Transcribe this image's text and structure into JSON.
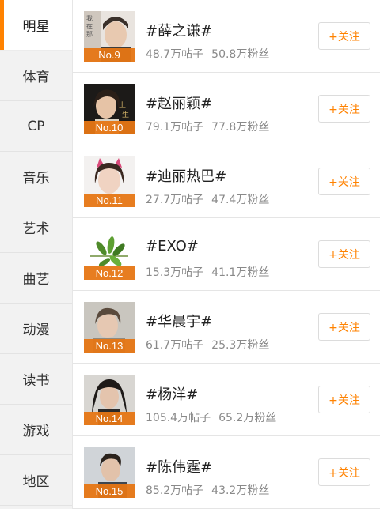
{
  "sidebar": {
    "items": [
      {
        "label": "明星",
        "active": true
      },
      {
        "label": "体育"
      },
      {
        "label": "CP"
      },
      {
        "label": "音乐"
      },
      {
        "label": "艺术"
      },
      {
        "label": "曲艺"
      },
      {
        "label": "动漫"
      },
      {
        "label": "读书"
      },
      {
        "label": "游戏"
      },
      {
        "label": "地区"
      }
    ]
  },
  "list": [
    {
      "rank": "No.9",
      "topic": "#薛之谦#",
      "posts": "48.7万帖子",
      "fans": "50.8万粉丝",
      "follow": "+关注"
    },
    {
      "rank": "No.10",
      "topic": "#赵丽颖#",
      "posts": "79.1万帖子",
      "fans": "77.8万粉丝",
      "follow": "+关注"
    },
    {
      "rank": "No.11",
      "topic": "#迪丽热巴#",
      "posts": "27.7万帖子",
      "fans": "47.4万粉丝",
      "follow": "+关注"
    },
    {
      "rank": "No.12",
      "topic": "#EXO#",
      "posts": "15.3万帖子",
      "fans": "41.1万粉丝",
      "follow": "+关注"
    },
    {
      "rank": "No.13",
      "topic": "#华晨宇#",
      "posts": "61.7万帖子",
      "fans": "25.3万粉丝",
      "follow": "+关注"
    },
    {
      "rank": "No.14",
      "topic": "#杨洋#",
      "posts": "105.4万帖子",
      "fans": "65.2万粉丝",
      "follow": "+关注"
    },
    {
      "rank": "No.15",
      "topic": "#陈伟霆#",
      "posts": "85.2万帖子",
      "fans": "43.2万粉丝",
      "follow": "+关注"
    }
  ],
  "colors": {
    "accent": "#ff8200",
    "rank_badge": "#e67614",
    "sidebar_bg": "#f2f2f2"
  }
}
